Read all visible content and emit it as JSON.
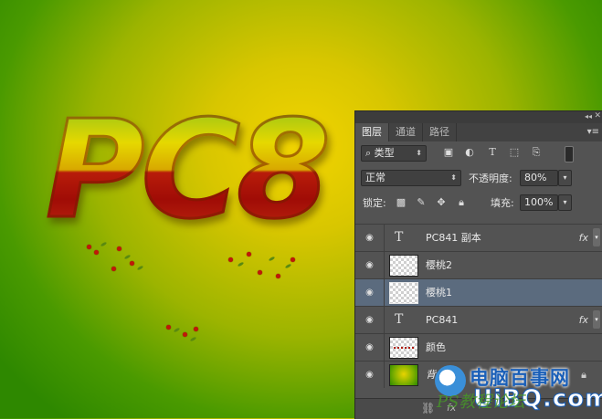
{
  "canvas": {
    "art_text": "PC8"
  },
  "panel": {
    "tabs": [
      {
        "label": "图层",
        "active": true
      },
      {
        "label": "通道",
        "active": false
      },
      {
        "label": "路径",
        "active": false
      }
    ],
    "filter": {
      "kind": "类型",
      "search_icon": "search-icon"
    },
    "blend_mode": "正常",
    "opacity_label": "不透明度:",
    "opacity_value": "80%",
    "lock_label": "锁定:",
    "fill_label": "填充:",
    "fill_value": "100%",
    "layers": [
      {
        "name": "PC841 副本",
        "type": "text",
        "fx": "fx",
        "selected": false
      },
      {
        "name": "樱桃2",
        "type": "pixel",
        "selected": false
      },
      {
        "name": "樱桃1",
        "type": "pixel",
        "selected": true
      },
      {
        "name": "PC841",
        "type": "text",
        "fx": "fx",
        "selected": false
      },
      {
        "name": "颜色",
        "type": "pixel",
        "selected": false
      },
      {
        "name": "背景",
        "type": "background",
        "locked": true,
        "selected": false
      }
    ],
    "bottom": {
      "fx_label": "fx"
    },
    "colors": {
      "panel_bg": "#535353",
      "selected_row": "#5b6b7e"
    }
  },
  "watermark": {
    "title": "电脑百事网",
    "domain": "UiBQ.com",
    "overlay_text": "PS教程论坛"
  }
}
